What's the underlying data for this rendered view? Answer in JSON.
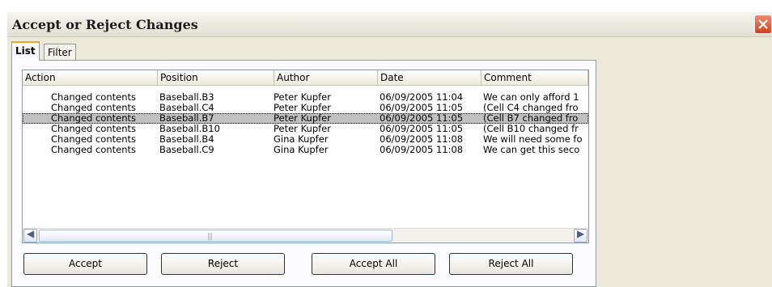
{
  "window": {
    "title": "Accept or Reject Changes"
  },
  "tabs": [
    {
      "label": "List",
      "active": true
    },
    {
      "label": "Filter",
      "active": false
    }
  ],
  "table": {
    "columns": [
      "Action",
      "Position",
      "Author",
      "Date",
      "Comment"
    ],
    "rows": [
      {
        "action": "Changed contents",
        "position": "Baseball.B3",
        "author": "Peter Kupfer",
        "date": "06/09/2005 11:04",
        "comment": "We can only afford 1",
        "selected": false
      },
      {
        "action": "Changed contents",
        "position": "Baseball.C4",
        "author": "Peter Kupfer",
        "date": "06/09/2005 11:05",
        "comment": "(Cell C4 changed fro",
        "selected": false
      },
      {
        "action": "Changed contents",
        "position": "Baseball.B7",
        "author": "Peter Kupfer",
        "date": "06/09/2005 11:05",
        "comment": "(Cell B7 changed fro",
        "selected": true
      },
      {
        "action": "Changed contents",
        "position": "Baseball.B10",
        "author": "Peter Kupfer",
        "date": "06/09/2005 11:05",
        "comment": "(Cell B10 changed fr",
        "selected": false
      },
      {
        "action": "Changed contents",
        "position": "Baseball.B4",
        "author": "Gina Kupfer",
        "date": "06/09/2005 11:08",
        "comment": "We will need some fo",
        "selected": false
      },
      {
        "action": "Changed contents",
        "position": "Baseball.C9",
        "author": "Gina Kupfer",
        "date": "06/09/2005 11:08",
        "comment": "We can get this seco",
        "selected": false
      }
    ]
  },
  "buttons": {
    "accept": "Accept",
    "reject": "Reject",
    "accept_all": "Accept All",
    "reject_all": "Reject All"
  },
  "icons": {
    "close": "close-icon",
    "scroll_left": "arrow-left-icon",
    "scroll_right": "arrow-right-icon",
    "grip": "scroll-grip-icon"
  },
  "colors": {
    "dialog_bg": "#ECE9D8",
    "selected_row": "#C0C0C0",
    "close_button": "#D4421F",
    "active_tab_accent": "#F5A623"
  }
}
